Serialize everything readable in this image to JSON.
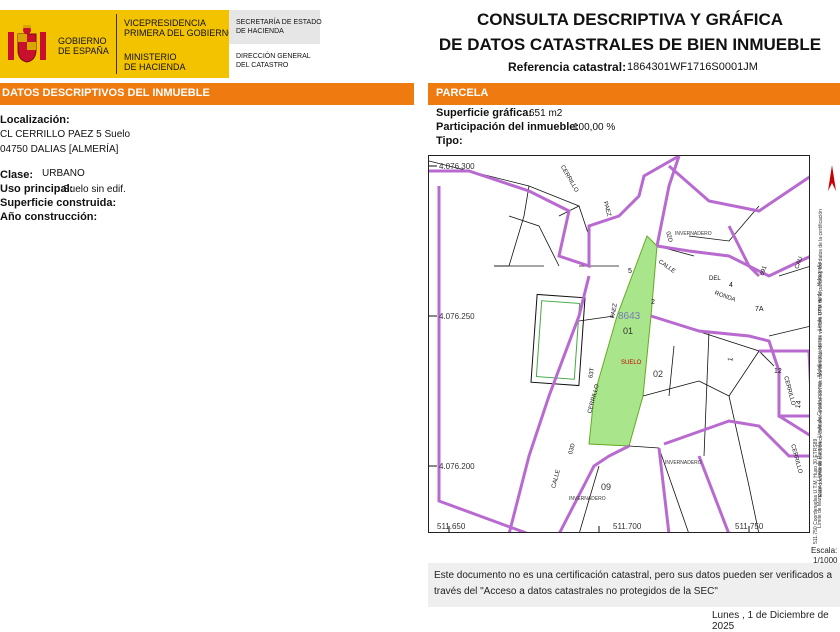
{
  "header": {
    "gov_line1": "GOBIERNO",
    "gov_line2": "DE ESPAÑA",
    "vice_line1": "VICEPRESIDENCIA",
    "vice_line2": "PRIMERA DEL GOBIERNO",
    "min_line1": "MINISTERIO",
    "min_line2": "DE HACIENDA",
    "sec_line1": "SECRETARÍA DE ESTADO",
    "sec_line2": "DE HACIENDA",
    "dg_line1": "DIRECCIÓN GENERAL",
    "dg_line2": "DEL CATASTRO",
    "title_line1": "CONSULTA DESCRIPTIVA Y GRÁFICA",
    "title_line2": "DE DATOS CATASTRALES DE BIEN INMUEBLE",
    "ref_label": "Referencia catastral:",
    "ref_value": "1864301WF1716S0001JM"
  },
  "left": {
    "bar_title": "DATOS DESCRIPTIVOS DEL INMUEBLE",
    "localizacion_label": "Localización:",
    "loc_line1": "CL CERRILLO PAEZ 5 Suelo",
    "loc_line2": "04750 DALIAS [ALMERÍA]",
    "clase_label": "Clase:",
    "clase_value": "URBANO",
    "uso_label": "Uso principal:",
    "uso_value": "Suelo sin edif.",
    "superficie_label": "Superficie construida:",
    "anio_label": "Año construcción:"
  },
  "right": {
    "bar_title": "PARCELA",
    "sup_label": "Superficie gráfica:",
    "sup_value": "651 m2",
    "part_label": "Participación del inmueble:",
    "part_value": "100,00 %",
    "tipo_label": "Tipo:"
  },
  "map": {
    "y_labels": [
      "4.076.300",
      "4.076.250",
      "4.076.200"
    ],
    "x_labels": [
      "511.650",
      "511.700",
      "511.750"
    ],
    "parcel_id": "8643",
    "parcel_01": "01",
    "parcel_02": "02",
    "parcel_09": "09",
    "suelo": "SUELO",
    "invernadero": "INVERNADERO",
    "street_cerrillo": "CERRILLO",
    "street_paez": "PAEZ",
    "street_calle": "CALLE",
    "street_del": "DEL",
    "street_ronda": "RONDA",
    "street_63t": "63T",
    "street_03d": "03D",
    "street_02d": "02D",
    "street_691": "691",
    "street_cau": "CAU",
    "n5": "5",
    "n2": "2",
    "n4": "4",
    "n7a": "7A",
    "n1": "1",
    "n12": "12",
    "n14": "14"
  },
  "legend": {
    "coords": "511.750 Coordenadas U.T.M. Huso 30 ETRS89",
    "l1": "Límite de Manzana",
    "l2": "Límite de Parcela",
    "l3": "Límite de Construcciones",
    "l4": "Mobiliario y aceras",
    "l5": "Límite zona verde",
    "l6": "Hidrografía",
    "note": "Este documento electrónico contiene anexos con las coordenadas de los vértices UTM de la parcela y los datos de la certificación",
    "scale_label": "Escala:",
    "scale_value": "1/1000"
  },
  "footer": {
    "line1": "Este documento no es una certificación catastral, pero sus datos pueden ser verificados a",
    "line2": "través del \"Acceso a datos catastrales no protegidos de la SEC\"",
    "date": "Lunes , 1 de Diciembre de 2025"
  }
}
